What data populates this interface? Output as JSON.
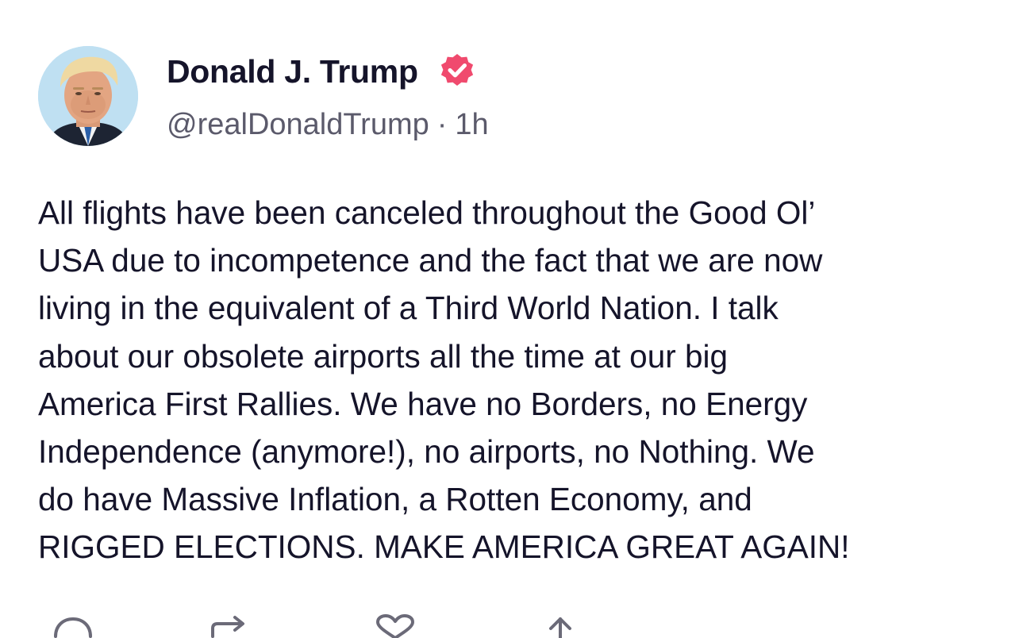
{
  "post": {
    "author": {
      "display_name": "Donald J. Trump",
      "handle": "@realDonaldTrump",
      "separator": "·",
      "time_ago": "1h",
      "verified_icon": "verified-badge-icon",
      "verified_color": "#f04a6e"
    },
    "body_lines": [
      "All flights have been canceled throughout the Good Ol’",
      "USA due to incompetence and the fact that we are now",
      "living in the equivalent of a Third World Nation. I talk",
      "about our obsolete airports all the time at our big",
      "America First Rallies. We have no Borders, no Energy",
      "Independence (anymore!), no airports, no Nothing. We",
      "do have Massive Inflation, a Rotten Economy, and",
      "RIGGED ELECTIONS. MAKE AMERICA GREAT AGAIN!"
    ],
    "actions": [
      {
        "icon": "reply-icon"
      },
      {
        "icon": "retruth-icon"
      },
      {
        "icon": "like-icon"
      },
      {
        "icon": "share-icon"
      }
    ]
  },
  "colors": {
    "text": "#15142a",
    "muted": "#5b5a6b",
    "accent": "#f04a6e"
  }
}
